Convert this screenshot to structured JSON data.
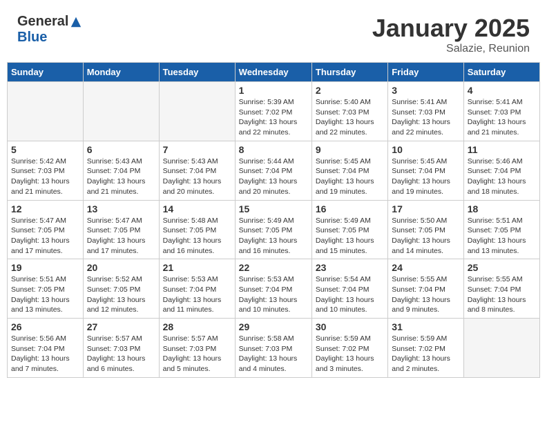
{
  "logo": {
    "general": "General",
    "blue": "Blue"
  },
  "title": {
    "month": "January 2025",
    "location": "Salazie, Reunion"
  },
  "weekdays": [
    "Sunday",
    "Monday",
    "Tuesday",
    "Wednesday",
    "Thursday",
    "Friday",
    "Saturday"
  ],
  "weeks": [
    [
      {
        "day": "",
        "info": ""
      },
      {
        "day": "",
        "info": ""
      },
      {
        "day": "",
        "info": ""
      },
      {
        "day": "1",
        "info": "Sunrise: 5:39 AM\nSunset: 7:02 PM\nDaylight: 13 hours\nand 22 minutes."
      },
      {
        "day": "2",
        "info": "Sunrise: 5:40 AM\nSunset: 7:03 PM\nDaylight: 13 hours\nand 22 minutes."
      },
      {
        "day": "3",
        "info": "Sunrise: 5:41 AM\nSunset: 7:03 PM\nDaylight: 13 hours\nand 22 minutes."
      },
      {
        "day": "4",
        "info": "Sunrise: 5:41 AM\nSunset: 7:03 PM\nDaylight: 13 hours\nand 21 minutes."
      }
    ],
    [
      {
        "day": "5",
        "info": "Sunrise: 5:42 AM\nSunset: 7:03 PM\nDaylight: 13 hours\nand 21 minutes."
      },
      {
        "day": "6",
        "info": "Sunrise: 5:43 AM\nSunset: 7:04 PM\nDaylight: 13 hours\nand 21 minutes."
      },
      {
        "day": "7",
        "info": "Sunrise: 5:43 AM\nSunset: 7:04 PM\nDaylight: 13 hours\nand 20 minutes."
      },
      {
        "day": "8",
        "info": "Sunrise: 5:44 AM\nSunset: 7:04 PM\nDaylight: 13 hours\nand 20 minutes."
      },
      {
        "day": "9",
        "info": "Sunrise: 5:45 AM\nSunset: 7:04 PM\nDaylight: 13 hours\nand 19 minutes."
      },
      {
        "day": "10",
        "info": "Sunrise: 5:45 AM\nSunset: 7:04 PM\nDaylight: 13 hours\nand 19 minutes."
      },
      {
        "day": "11",
        "info": "Sunrise: 5:46 AM\nSunset: 7:04 PM\nDaylight: 13 hours\nand 18 minutes."
      }
    ],
    [
      {
        "day": "12",
        "info": "Sunrise: 5:47 AM\nSunset: 7:05 PM\nDaylight: 13 hours\nand 17 minutes."
      },
      {
        "day": "13",
        "info": "Sunrise: 5:47 AM\nSunset: 7:05 PM\nDaylight: 13 hours\nand 17 minutes."
      },
      {
        "day": "14",
        "info": "Sunrise: 5:48 AM\nSunset: 7:05 PM\nDaylight: 13 hours\nand 16 minutes."
      },
      {
        "day": "15",
        "info": "Sunrise: 5:49 AM\nSunset: 7:05 PM\nDaylight: 13 hours\nand 16 minutes."
      },
      {
        "day": "16",
        "info": "Sunrise: 5:49 AM\nSunset: 7:05 PM\nDaylight: 13 hours\nand 15 minutes."
      },
      {
        "day": "17",
        "info": "Sunrise: 5:50 AM\nSunset: 7:05 PM\nDaylight: 13 hours\nand 14 minutes."
      },
      {
        "day": "18",
        "info": "Sunrise: 5:51 AM\nSunset: 7:05 PM\nDaylight: 13 hours\nand 13 minutes."
      }
    ],
    [
      {
        "day": "19",
        "info": "Sunrise: 5:51 AM\nSunset: 7:05 PM\nDaylight: 13 hours\nand 13 minutes."
      },
      {
        "day": "20",
        "info": "Sunrise: 5:52 AM\nSunset: 7:05 PM\nDaylight: 13 hours\nand 12 minutes."
      },
      {
        "day": "21",
        "info": "Sunrise: 5:53 AM\nSunset: 7:04 PM\nDaylight: 13 hours\nand 11 minutes."
      },
      {
        "day": "22",
        "info": "Sunrise: 5:53 AM\nSunset: 7:04 PM\nDaylight: 13 hours\nand 10 minutes."
      },
      {
        "day": "23",
        "info": "Sunrise: 5:54 AM\nSunset: 7:04 PM\nDaylight: 13 hours\nand 10 minutes."
      },
      {
        "day": "24",
        "info": "Sunrise: 5:55 AM\nSunset: 7:04 PM\nDaylight: 13 hours\nand 9 minutes."
      },
      {
        "day": "25",
        "info": "Sunrise: 5:55 AM\nSunset: 7:04 PM\nDaylight: 13 hours\nand 8 minutes."
      }
    ],
    [
      {
        "day": "26",
        "info": "Sunrise: 5:56 AM\nSunset: 7:04 PM\nDaylight: 13 hours\nand 7 minutes."
      },
      {
        "day": "27",
        "info": "Sunrise: 5:57 AM\nSunset: 7:03 PM\nDaylight: 13 hours\nand 6 minutes."
      },
      {
        "day": "28",
        "info": "Sunrise: 5:57 AM\nSunset: 7:03 PM\nDaylight: 13 hours\nand 5 minutes."
      },
      {
        "day": "29",
        "info": "Sunrise: 5:58 AM\nSunset: 7:03 PM\nDaylight: 13 hours\nand 4 minutes."
      },
      {
        "day": "30",
        "info": "Sunrise: 5:59 AM\nSunset: 7:02 PM\nDaylight: 13 hours\nand 3 minutes."
      },
      {
        "day": "31",
        "info": "Sunrise: 5:59 AM\nSunset: 7:02 PM\nDaylight: 13 hours\nand 2 minutes."
      },
      {
        "day": "",
        "info": ""
      }
    ]
  ]
}
